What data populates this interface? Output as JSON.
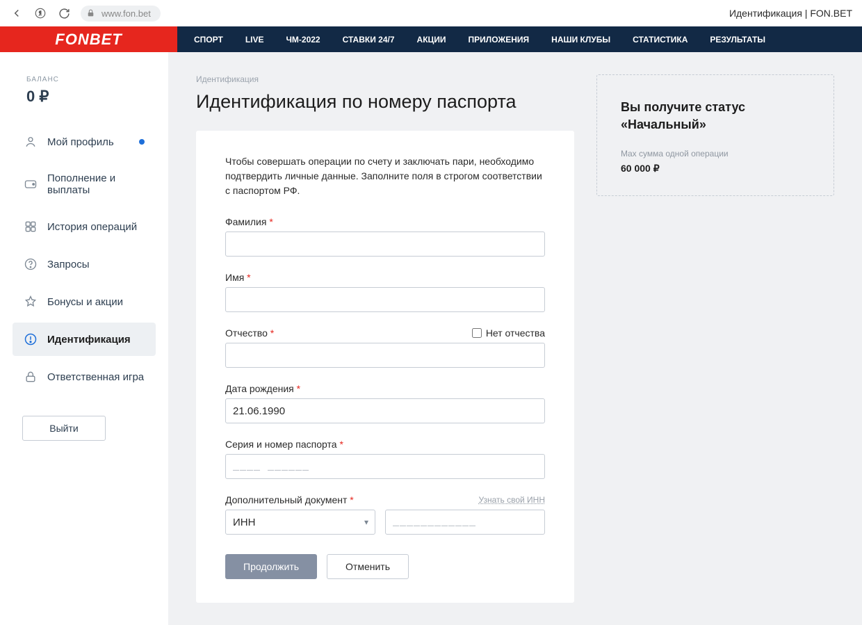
{
  "browser": {
    "url": "www.fon.bet",
    "page_title": "Идентификация | FON.BET"
  },
  "logo": "FONBET",
  "nav": {
    "items": [
      "СПОРТ",
      "LIVE",
      "ЧМ-2022",
      "СТАВКИ 24/7",
      "АКЦИИ",
      "ПРИЛОЖЕНИЯ",
      "НАШИ КЛУБЫ",
      "СТАТИСТИКА",
      "РЕЗУЛЬТАТЫ"
    ]
  },
  "sidebar": {
    "balance_label": "БАЛАНС",
    "balance_value": "0 ₽",
    "items": [
      {
        "label": "Мой профиль"
      },
      {
        "label": "Пополнение и выплаты"
      },
      {
        "label": "История операций"
      },
      {
        "label": "Запросы"
      },
      {
        "label": "Бонусы и акции"
      },
      {
        "label": "Идентификация"
      },
      {
        "label": "Ответственная игра"
      }
    ],
    "logout": "Выйти"
  },
  "main": {
    "breadcrumb": "Идентификация",
    "heading": "Идентификация по номеру паспорта",
    "intro": "Чтобы совершать операции по счету и заключать пари, необходимо подтвердить личные данные. Заполните поля в строгом соответствии с паспортом РФ.",
    "fields": {
      "lastname_label": "Фамилия",
      "firstname_label": "Имя",
      "patronymic_label": "Отчество",
      "no_patronymic_label": "Нет отчества",
      "dob_label": "Дата рождения",
      "dob_value": "21.06.1990",
      "passport_label": "Серия и номер паспорта",
      "passport_placeholder": "____ ______",
      "adddoc_label": "Дополнительный документ",
      "adddoc_value": "ИНН",
      "adddoc_num_placeholder": "____________",
      "know_inn": "Узнать свой ИНН"
    },
    "actions": {
      "continue": "Продолжить",
      "cancel": "Отменить"
    }
  },
  "status": {
    "title": "Вы получите статус «Начальный»",
    "cap": "Max сумма одной операции",
    "amount": "60 000 ₽"
  }
}
